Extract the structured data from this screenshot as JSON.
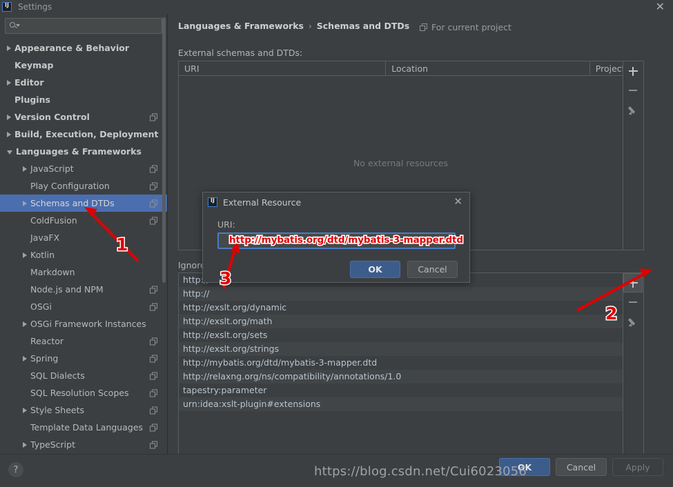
{
  "window": {
    "title": "Settings",
    "close_label": "✕",
    "logo": "intellij-idea-logo"
  },
  "sidebar": {
    "search": {
      "value": "",
      "placeholder": ""
    },
    "items": [
      {
        "label": "Appearance & Behavior",
        "twisty": "closed",
        "bold": true,
        "copy": false,
        "indent": 0,
        "selected": false
      },
      {
        "label": "Keymap",
        "twisty": "none",
        "bold": true,
        "copy": false,
        "indent": 0,
        "selected": false
      },
      {
        "label": "Editor",
        "twisty": "closed",
        "bold": true,
        "copy": false,
        "indent": 0,
        "selected": false
      },
      {
        "label": "Plugins",
        "twisty": "none",
        "bold": true,
        "copy": false,
        "indent": 0,
        "selected": false
      },
      {
        "label": "Version Control",
        "twisty": "closed",
        "bold": true,
        "copy": true,
        "indent": 0,
        "selected": false
      },
      {
        "label": "Build, Execution, Deployment",
        "twisty": "closed",
        "bold": true,
        "copy": false,
        "indent": 0,
        "selected": false
      },
      {
        "label": "Languages & Frameworks",
        "twisty": "open",
        "bold": true,
        "copy": false,
        "indent": 0,
        "selected": false
      },
      {
        "label": "JavaScript",
        "twisty": "closed",
        "bold": false,
        "copy": true,
        "indent": 1,
        "selected": false
      },
      {
        "label": "Play Configuration",
        "twisty": "none",
        "bold": false,
        "copy": true,
        "indent": 1,
        "selected": false
      },
      {
        "label": "Schemas and DTDs",
        "twisty": "closed",
        "bold": false,
        "copy": true,
        "indent": 1,
        "selected": true
      },
      {
        "label": "ColdFusion",
        "twisty": "none",
        "bold": false,
        "copy": true,
        "indent": 1,
        "selected": false
      },
      {
        "label": "JavaFX",
        "twisty": "none",
        "bold": false,
        "copy": false,
        "indent": 1,
        "selected": false
      },
      {
        "label": "Kotlin",
        "twisty": "closed",
        "bold": false,
        "copy": false,
        "indent": 1,
        "selected": false
      },
      {
        "label": "Markdown",
        "twisty": "none",
        "bold": false,
        "copy": false,
        "indent": 1,
        "selected": false
      },
      {
        "label": "Node.js and NPM",
        "twisty": "none",
        "bold": false,
        "copy": true,
        "indent": 1,
        "selected": false
      },
      {
        "label": "OSGi",
        "twisty": "none",
        "bold": false,
        "copy": true,
        "indent": 1,
        "selected": false
      },
      {
        "label": "OSGi Framework Instances",
        "twisty": "closed",
        "bold": false,
        "copy": false,
        "indent": 1,
        "selected": false
      },
      {
        "label": "Reactor",
        "twisty": "none",
        "bold": false,
        "copy": true,
        "indent": 1,
        "selected": false
      },
      {
        "label": "Spring",
        "twisty": "closed",
        "bold": false,
        "copy": true,
        "indent": 1,
        "selected": false
      },
      {
        "label": "SQL Dialects",
        "twisty": "none",
        "bold": false,
        "copy": true,
        "indent": 1,
        "selected": false
      },
      {
        "label": "SQL Resolution Scopes",
        "twisty": "none",
        "bold": false,
        "copy": true,
        "indent": 1,
        "selected": false
      },
      {
        "label": "Style Sheets",
        "twisty": "closed",
        "bold": false,
        "copy": true,
        "indent": 1,
        "selected": false
      },
      {
        "label": "Template Data Languages",
        "twisty": "none",
        "bold": false,
        "copy": true,
        "indent": 1,
        "selected": false
      },
      {
        "label": "TypeScript",
        "twisty": "closed",
        "bold": false,
        "copy": true,
        "indent": 1,
        "selected": false
      }
    ]
  },
  "main": {
    "breadcrumb": {
      "parent": "Languages & Frameworks",
      "separator": "›",
      "current": "Schemas and DTDs"
    },
    "for_current_project": "For current project",
    "external_section_label": "External schemas and DTDs:",
    "external_table": {
      "columns": [
        "URI",
        "Location",
        "Project"
      ],
      "empty_text": "No external resources",
      "rows": []
    },
    "side_buttons": {
      "add": "+",
      "remove": "−",
      "edit": "pencil"
    },
    "ignored_section_label": "Ignored",
    "ignored_rows": [
      "http://",
      "http://",
      "http://exslt.org/dynamic",
      "http://exslt.org/math",
      "http://exslt.org/sets",
      "http://exslt.org/strings",
      "http://mybatis.org/dtd/mybatis-3-mapper.dtd",
      "http://relaxng.org/ns/compatibility/annotations/1.0",
      "tapestry:parameter",
      "urn:idea:xslt-plugin#extensions"
    ]
  },
  "dialog": {
    "title": "External Resource",
    "close_label": "✕",
    "uri_label": "URI:",
    "uri_value": "",
    "ok_label": "OK",
    "cancel_label": "Cancel"
  },
  "footer": {
    "help_label": "?",
    "ok_label": "OK",
    "cancel_label": "Cancel",
    "apply_label": "Apply"
  },
  "annotations": {
    "uri_callout": "http://mybatis.org/dtd/mybatis-3-mapper.dtd",
    "marker_1": "1",
    "marker_2": "2",
    "marker_3": "3",
    "watermark": "https://blog.csdn.net/Cui6023056",
    "arrow_color": "#e00000"
  }
}
